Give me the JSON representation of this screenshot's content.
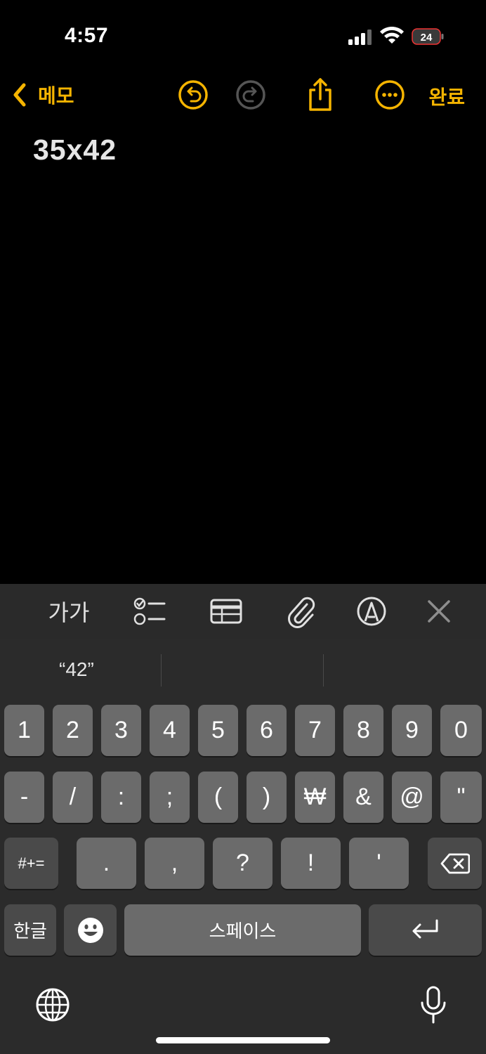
{
  "status_bar": {
    "time": "4:57",
    "battery_level": "24"
  },
  "nav": {
    "back_label": "메모",
    "done_label": "완료"
  },
  "note": {
    "text": "35x42"
  },
  "toolbar": {
    "text_format_label": "가가"
  },
  "keyboard": {
    "suggestions": [
      "“42”",
      "",
      ""
    ],
    "row1": [
      "1",
      "2",
      "3",
      "4",
      "5",
      "6",
      "7",
      "8",
      "9",
      "0"
    ],
    "row2": [
      "-",
      "/",
      ":",
      ";",
      "(",
      ")",
      "₩",
      "&",
      "@",
      "\""
    ],
    "row3": [
      ".",
      ",",
      "?",
      "!",
      "'"
    ],
    "symbols_key": "#+=",
    "hangul_key": "한글",
    "space_key": "스페이스"
  },
  "colors": {
    "accent": "#f5b400",
    "background": "#000000",
    "keyboard": "#2b2b2b",
    "key": "#6b6b6b"
  }
}
